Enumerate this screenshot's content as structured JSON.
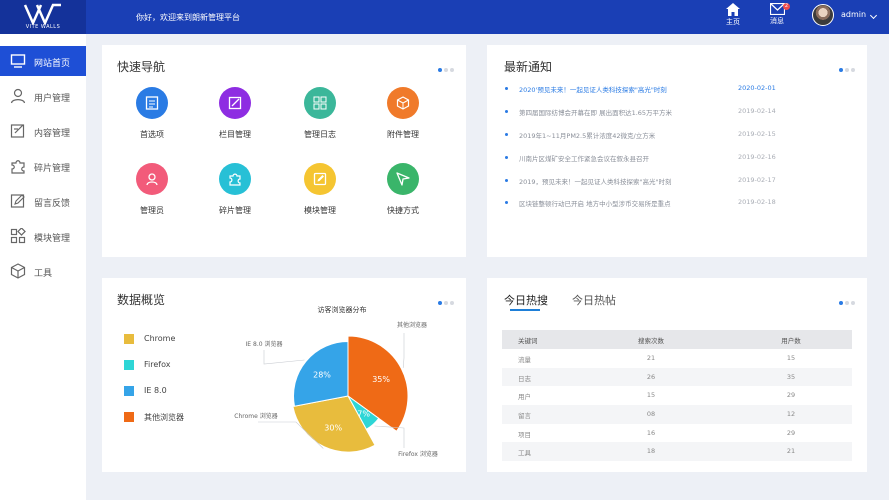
{
  "header": {
    "brand": "VITE WALLS",
    "welcome": "你好，欢迎来到朗新管理平台",
    "home_label": "主页",
    "message_label": "消息",
    "message_badge": "2",
    "username": "admin"
  },
  "sidebar": {
    "items": [
      {
        "label": "网站首页",
        "icon": "monitor-icon",
        "active": true
      },
      {
        "label": "用户管理",
        "icon": "user-icon",
        "active": false
      },
      {
        "label": "内容管理",
        "icon": "edit-icon",
        "active": false
      },
      {
        "label": "碎片管理",
        "icon": "puzzle-icon",
        "active": false
      },
      {
        "label": "留言反馈",
        "icon": "feedback-icon",
        "active": false
      },
      {
        "label": "模块管理",
        "icon": "modules-icon",
        "active": false
      },
      {
        "label": "工具",
        "icon": "cube-icon",
        "active": false
      }
    ]
  },
  "quick_nav": {
    "title": "快速导航",
    "items": [
      {
        "label": "首选项",
        "color": "#2a7be4",
        "icon": "list-icon"
      },
      {
        "label": "栏目管理",
        "color": "#8e2de2",
        "icon": "edit-icon"
      },
      {
        "label": "管理日志",
        "color": "#3bb79a",
        "icon": "grid-icon"
      },
      {
        "label": "附件管理",
        "color": "#f07a2a",
        "icon": "box-icon"
      },
      {
        "label": "管理员",
        "color": "#f25b7a",
        "icon": "user-icon"
      },
      {
        "label": "碎片管理",
        "color": "#27c0d6",
        "icon": "puzzle-icon"
      },
      {
        "label": "模块管理",
        "color": "#f5c531",
        "icon": "edit-square-icon"
      },
      {
        "label": "快捷方式",
        "color": "#3ab56a",
        "icon": "send-icon"
      }
    ]
  },
  "notices": {
    "title": "最新通知",
    "items": [
      {
        "text": "2020'预见未来！一起见证人类科技探索\"高光\"时刻",
        "date": "2020-02-01"
      },
      {
        "text": "第四届国际纺博会开幕在即 展出面积达1.65万平方米",
        "date": "2019-02-14"
      },
      {
        "text": "2019年1~11月PM2.5累计浓度42微克/立方米",
        "date": "2019-02-15"
      },
      {
        "text": "川南片区煤矿安全工作紧急会议在叙永县召开",
        "date": "2019-02-16"
      },
      {
        "text": "2019，预见未来！一起见证人类科技探索\"高光\"时刻",
        "date": "2019-02-17"
      },
      {
        "text": "区块链整顿行动已开启 地方中小型涉币交易所是重点",
        "date": "2019-02-18"
      }
    ]
  },
  "data_overview": {
    "title": "数据概览",
    "legend": [
      {
        "name": "Chrome",
        "color": "#e8bc3d"
      },
      {
        "name": "Firefox",
        "color": "#2ed6d6"
      },
      {
        "name": "IE 8.0",
        "color": "#35a4e8"
      },
      {
        "name": "其他浏览器",
        "color": "#ef6a16"
      }
    ]
  },
  "chart_data": {
    "type": "pie",
    "title": "访客浏览器分布",
    "rose": true,
    "series": [
      {
        "name": "其他浏览器",
        "value": 35,
        "label": "35%",
        "outer_label": "其他浏览器",
        "color": "#ef6a16"
      },
      {
        "name": "Firefox",
        "value": 7,
        "label": "7%",
        "outer_label": "Firefox 浏览器",
        "color": "#2ed6d6"
      },
      {
        "name": "Chrome",
        "value": 30,
        "label": "30%",
        "outer_label": "Chrome 浏览器",
        "color": "#e8bc3d"
      },
      {
        "name": "IE 8.0",
        "value": 28,
        "label": "28%",
        "outer_label": "IE 8.0 浏览器",
        "color": "#35a4e8"
      }
    ]
  },
  "hot": {
    "tabs": [
      {
        "label": "今日热搜",
        "active": true
      },
      {
        "label": "今日热帖",
        "active": false
      }
    ],
    "columns": [
      "关键词",
      "搜索次数",
      "用户数"
    ],
    "rows": [
      [
        "流量",
        "21",
        "15"
      ],
      [
        "日志",
        "26",
        "35"
      ],
      [
        "用户",
        "15",
        "29"
      ],
      [
        "留言",
        "08",
        "12"
      ],
      [
        "项目",
        "16",
        "29"
      ],
      [
        "工具",
        "18",
        "21"
      ]
    ]
  }
}
